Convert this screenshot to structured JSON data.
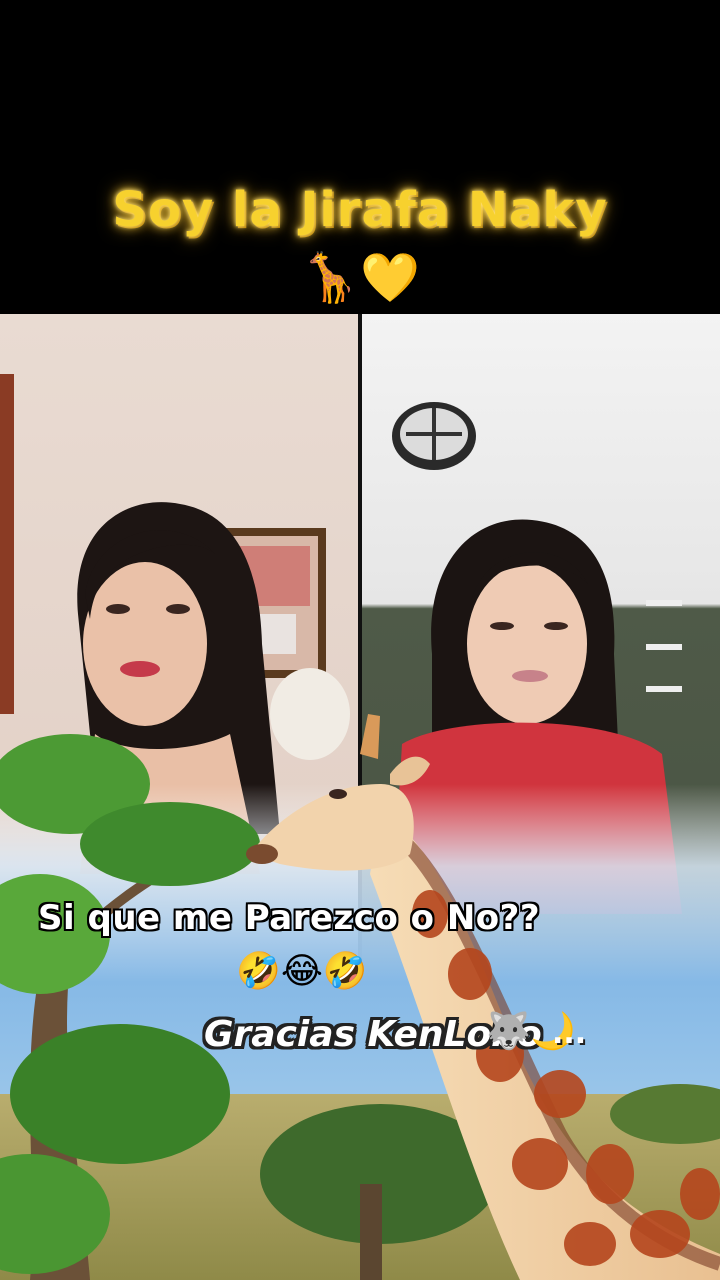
{
  "header": {
    "title": "Soy la Jirafa Naky",
    "title_emoji": "🦒💛"
  },
  "overlay": {
    "caption": "Si que me Parezco o No??",
    "caption_emoji": "🤣😂🤣",
    "credit": "Gracias KenLobo",
    "credit_emoji": "🐺🌙",
    "credit_ellipsis": "..."
  },
  "colors": {
    "title_gold": "#f7d12e",
    "background": "#000000",
    "sky_blue": "#7fb7e6",
    "foliage_green": "#3f8a2d",
    "giraffe_spot": "#b5461d"
  }
}
